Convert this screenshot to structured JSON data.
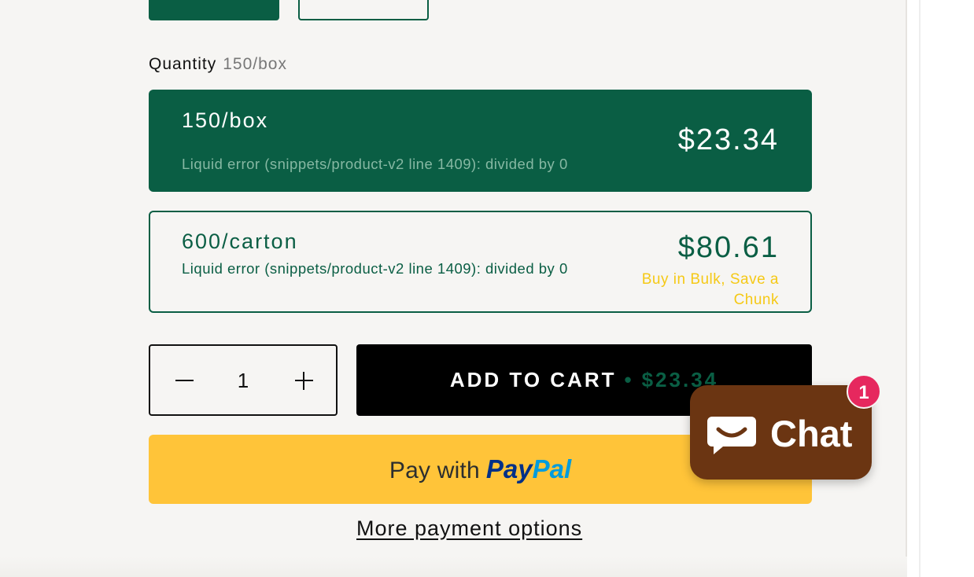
{
  "quantity_section": {
    "heading": "Quantity",
    "selected_value": "150/box"
  },
  "options": [
    {
      "name": "150/box",
      "error": "Liquid error (snippets/product-v2 line 1409): divided by 0",
      "price": "$23.34",
      "selected": true
    },
    {
      "name": "600/carton",
      "error": "Liquid error (snippets/product-v2 line 1409): divided by 0",
      "price": "$80.61",
      "promo": "Buy in Bulk, Save a Chunk",
      "selected": false
    }
  ],
  "stepper": {
    "value": "1"
  },
  "add_to_cart": {
    "label": "ADD TO CART",
    "separator": "•",
    "price": "$23.34"
  },
  "paypal": {
    "prefix": "Pay with",
    "brand_pay": "Pay",
    "brand_pal": "Pal"
  },
  "more_payment_options": "More payment options",
  "chat": {
    "label": "Chat",
    "badge_count": "1"
  },
  "colors": {
    "brand_green": "#0a5e44",
    "promo_yellow": "#f5c916",
    "paypal_yellow": "#ffc439",
    "chat_brown": "#6b3512",
    "badge_pink": "#e6285e"
  },
  "icons": [
    "minus-icon",
    "plus-icon",
    "chat-bubble-icon"
  ]
}
